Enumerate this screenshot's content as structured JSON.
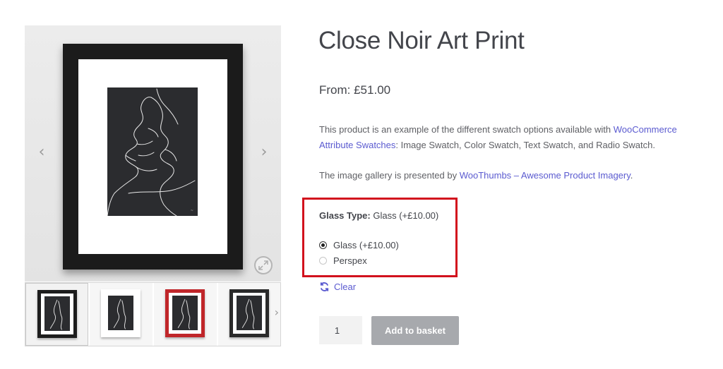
{
  "gallery": {
    "prev_arrow": "‹",
    "next_arrow": "›",
    "thumbs_next_arrow": "›",
    "zoom_icon": "zoom-expand-icon",
    "thumbnails": [
      {
        "frame_color": "#1d1d1d",
        "active": true
      },
      {
        "frame_color": "#ffffff",
        "active": false
      },
      {
        "frame_color": "#c0262a",
        "active": false
      },
      {
        "frame_color": "#2a2a2a",
        "active": false
      }
    ]
  },
  "product": {
    "title": "Close Noir Art Print",
    "price": "From: £51.00",
    "desc1": {
      "text": "This product is an example of the different swatch options available with ",
      "link": "WooCommerce Attribute Swatches",
      "after": ": Image Swatch, Color Swatch, Text Swatch, and Radio Swatch."
    },
    "desc2": {
      "text": "The image gallery is presented by ",
      "link": "WooThumbs – Awesome Product Imagery",
      "after": "."
    }
  },
  "variation": {
    "label": "Glass Type",
    "selected": "Glass (+£10.00)",
    "options": [
      {
        "label": "Glass (+£10.00)",
        "checked": true
      },
      {
        "label": "Perspex",
        "checked": false
      }
    ],
    "clear_label": "Clear"
  },
  "cart": {
    "quantity": "1",
    "add_label": "Add to basket"
  },
  "colors": {
    "link": "#5b5bd0",
    "highlight_border": "#d2111d",
    "button_bg": "#a7a9ad"
  }
}
